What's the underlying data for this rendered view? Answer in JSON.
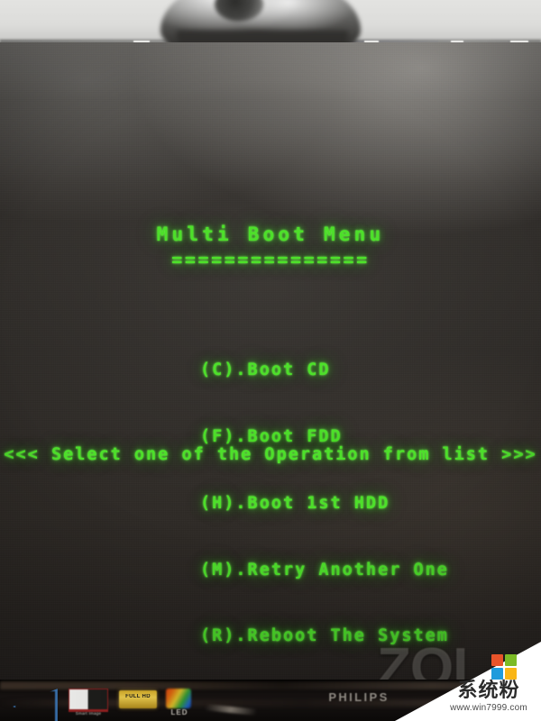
{
  "scene": {
    "device_brand": "PHILIPS",
    "screen_colors": {
      "phosphor_green": "#4de02a",
      "screen_black": "#2e2a26",
      "wall_gray": "#dcdcda"
    }
  },
  "bios": {
    "title": "Multi Boot Menu",
    "rule": "===============",
    "options": [
      {
        "key": "C",
        "label": "(C).Boot CD"
      },
      {
        "key": "F",
        "label": "(F).Boot FDD"
      },
      {
        "key": "H",
        "label": "(H).Boot 1st HDD"
      },
      {
        "key": "M",
        "label": "(M).Retry Another One"
      },
      {
        "key": "R",
        "label": "(R).Reboot The System"
      }
    ],
    "prompt": "<<< Select one of the Operation from list >>>"
  },
  "bezel": {
    "brand_label": "PHILIPS",
    "stickers": [
      {
        "name": "smart-image",
        "label": "Smart Image"
      },
      {
        "name": "full-hd",
        "label": "FULL HD"
      },
      {
        "name": "led",
        "label": "LED"
      }
    ]
  },
  "watermark": {
    "ghost_text": "ZOL",
    "site_name": "系统粉",
    "site_url": "www.win7999.com",
    "logo_colors": {
      "top_left": "#e8542a",
      "top_right": "#7cbb26",
      "bottom_left": "#1f9bdc",
      "bottom_right": "#f9b515"
    }
  }
}
